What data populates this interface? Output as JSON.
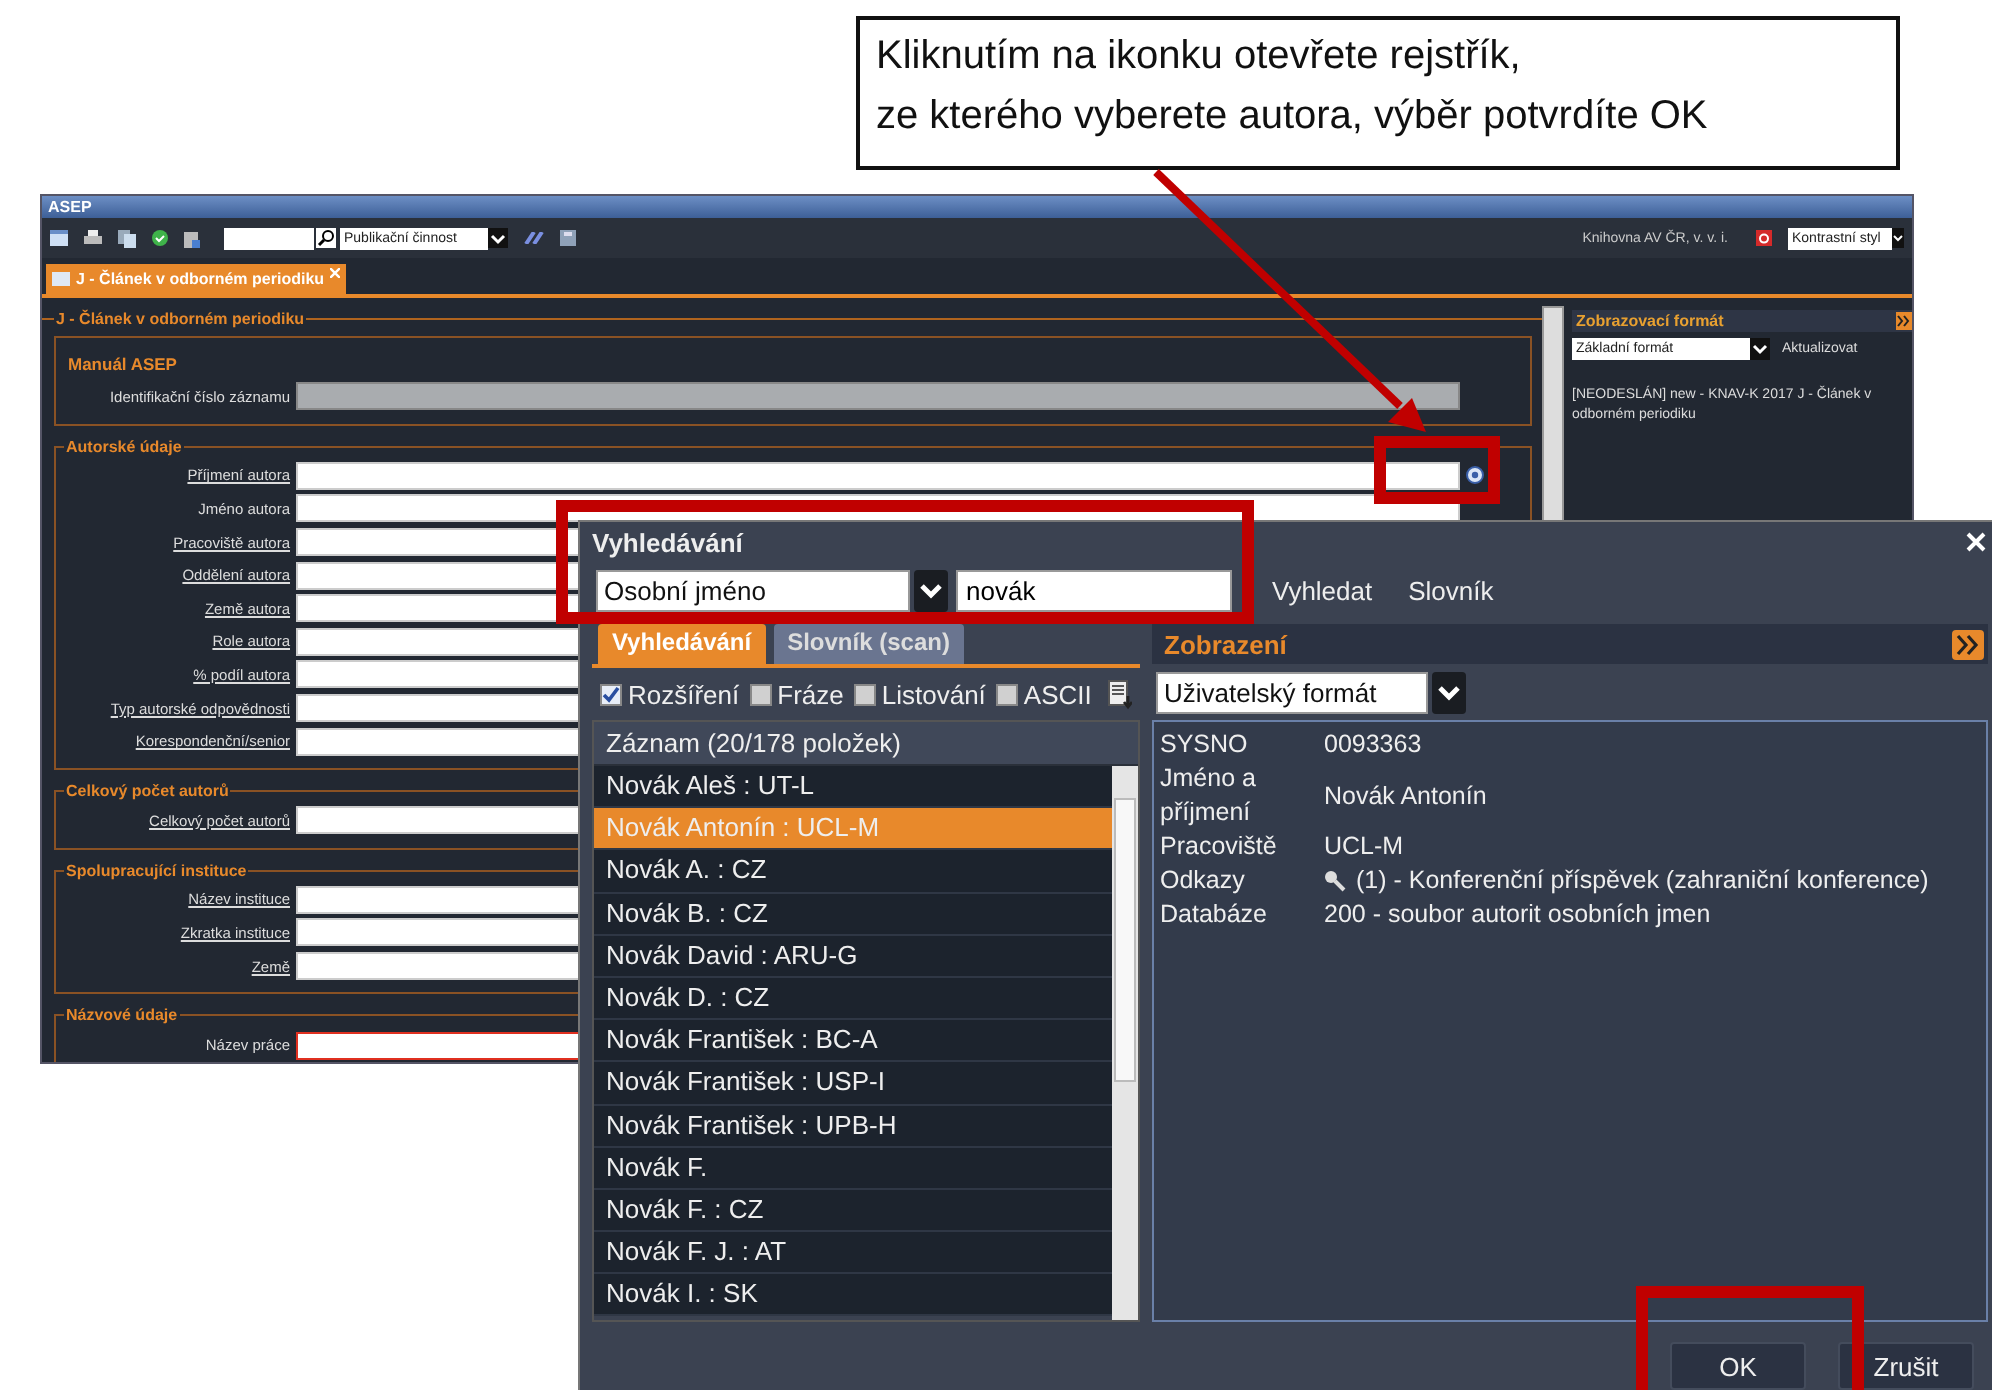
{
  "callout": {
    "lines": [
      "Kliknutím na ikonku otevřete rejstřík,",
      "ze kterého vyberete autora, výběr potvrdíte OK"
    ]
  },
  "main_window": {
    "title": "ASEP",
    "toolbar": {
      "category_select": "Publikační činnost",
      "institution": "Knihovna AV ČR, v. v. i.",
      "style_select": "Kontrastní styl"
    },
    "tabs": [
      {
        "label": "J - Článek v odborném periodiku",
        "selected": true
      }
    ],
    "form": {
      "title": "J - Článek v odborném periodiku",
      "sections": [
        {
          "title": "Manuál ASEP",
          "kind": "box",
          "fields": [
            {
              "label": "Identifikační číslo záznamu",
              "link": false,
              "kind": "readonly"
            }
          ]
        },
        {
          "title": "Autorské údaje",
          "kind": "legend",
          "fields": [
            {
              "label": "Příjmení autora",
              "link": true,
              "kind": "lookup"
            },
            {
              "label": "Jméno autora",
              "link": false,
              "kind": "text"
            },
            {
              "label": "Pracoviště autora",
              "link": true,
              "kind": "text"
            },
            {
              "label": "Oddělení autora",
              "link": true,
              "kind": "text"
            },
            {
              "label": "Země autora",
              "link": true,
              "kind": "text"
            },
            {
              "label": "Role autora",
              "link": true,
              "kind": "text"
            },
            {
              "label": "% podíl autora",
              "link": true,
              "kind": "text"
            },
            {
              "label": "Typ autorské odpovědnosti",
              "link": true,
              "kind": "text"
            },
            {
              "label": "Korespondenční/senior",
              "link": true,
              "kind": "text"
            }
          ]
        },
        {
          "title": "Celkový počet autorů",
          "kind": "legend",
          "fields": [
            {
              "label": "Celkový počet autorů",
              "link": true,
              "kind": "text"
            }
          ]
        },
        {
          "title": "Spolupracující instituce",
          "kind": "legend",
          "fields": [
            {
              "label": "Název instituce",
              "link": true,
              "kind": "text"
            },
            {
              "label": "Zkratka instituce",
              "link": true,
              "kind": "text"
            },
            {
              "label": "Země",
              "link": true,
              "kind": "text"
            }
          ]
        },
        {
          "title": "Názvové údaje",
          "kind": "legend",
          "fields": [
            {
              "label": "Název práce",
              "link": false,
              "kind": "required"
            }
          ]
        }
      ]
    },
    "side_panel": {
      "title": "Zobrazovací formát",
      "format_select": "Základní formát",
      "refresh_button": "Aktualizovat",
      "record_text": "[NEODESLÁN] new - KNAV-K 2017 J - Článek v odborném periodiku"
    }
  },
  "dialog": {
    "title": "Vyhledávání",
    "index_select": "Osobní jméno",
    "query": "novák",
    "buttons": [
      "Vyhledat",
      "Slovník"
    ],
    "tabs": [
      {
        "label": "Vyhledávání",
        "selected": true
      },
      {
        "label": "Slovník (scan)",
        "selected": false
      }
    ],
    "options": [
      {
        "label": "Rozšíření",
        "checked": true
      },
      {
        "label": "Fráze",
        "checked": false
      },
      {
        "label": "Listování",
        "checked": false
      },
      {
        "label": "ASCII",
        "checked": false
      }
    ],
    "list": {
      "header": "Záznam (20/178 položek)",
      "items": [
        {
          "label": "Novák Aleš : UT-L",
          "selected": false
        },
        {
          "label": "Novák Antonín : UCL-M",
          "selected": true
        },
        {
          "label": "Novák A. : CZ",
          "selected": false
        },
        {
          "label": "Novák B. : CZ",
          "selected": false
        },
        {
          "label": "Novák David : ARU-G",
          "selected": false
        },
        {
          "label": "Novák D. : CZ",
          "selected": false
        },
        {
          "label": "Novák František : BC-A",
          "selected": false
        },
        {
          "label": "Novák František : USP-I",
          "selected": false
        },
        {
          "label": "Novák František : UPB-H",
          "selected": false
        },
        {
          "label": "Novák F.",
          "selected": false
        },
        {
          "label": "Novák F. : CZ",
          "selected": false
        },
        {
          "label": "Novák F. J. : AT",
          "selected": false
        },
        {
          "label": "Novák I. : SK",
          "selected": false
        }
      ]
    },
    "detail": {
      "title": "Zobrazení",
      "format_select": "Uživatelský formát",
      "rows": [
        {
          "label": "SYSNO",
          "value": "0093363",
          "kind": "text"
        },
        {
          "label": "Jméno a příjmení",
          "value": "Novák Antonín",
          "kind": "text"
        },
        {
          "label": "Pracoviště",
          "value": "UCL-M",
          "kind": "text"
        },
        {
          "label": "Odkazy",
          "value": "(1) - Konferenční příspěvek (zahraniční konference)",
          "kind": "link"
        },
        {
          "label": "Databáze",
          "value": "200 - soubor autorit osobních jmen",
          "kind": "text"
        }
      ]
    },
    "footer_buttons": [
      "OK",
      "Zrušit"
    ]
  }
}
